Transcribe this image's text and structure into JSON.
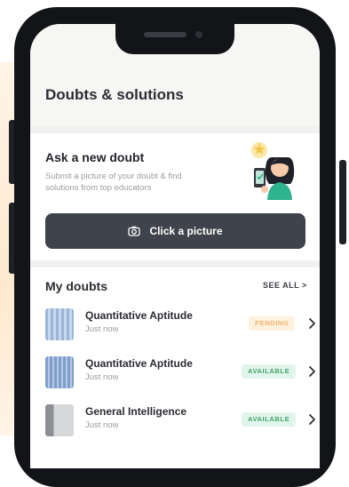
{
  "page": {
    "title": "Doubts & solutions"
  },
  "ask": {
    "title": "Ask a new doubt",
    "subtitle": "Submit a picture of your doubt & find solutions from top educators",
    "button_label": "Click a picture"
  },
  "my_doubts": {
    "title": "My doubts",
    "see_all": "SEE ALL >",
    "items": [
      {
        "subject": "Quantitative Aptitude",
        "time": "Just now",
        "status": "PENDING"
      },
      {
        "subject": "Quantitative Aptitude",
        "time": "Just now",
        "status": "AVAILABLE"
      },
      {
        "subject": "General Intelligence",
        "time": "Just now",
        "status": "AVAILABLE"
      }
    ]
  },
  "colors": {
    "button_bg": "#3f434b",
    "pending_bg": "#fff1de",
    "pending_text": "#f0b36e",
    "available_bg": "#e2f5ea",
    "available_text": "#3ca36a",
    "phone_frame": "#121418"
  },
  "icons": {
    "camera": "camera-icon",
    "chevron": "chevron-right-icon"
  }
}
